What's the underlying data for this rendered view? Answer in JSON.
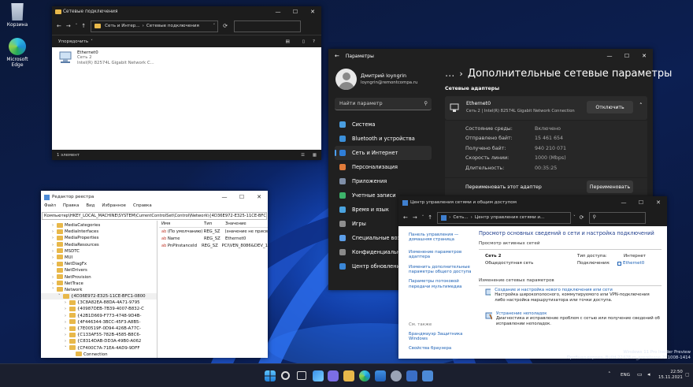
{
  "desktop": {
    "icons": [
      {
        "label": "Корзина"
      },
      {
        "label": "Microsoft\nEdge"
      }
    ],
    "watermark": {
      "line1": "Windows 11 Pro Insider Preview",
      "line2": "Пробная версия. Build 22478.rs_prerelease.211008-1414"
    }
  },
  "explorer": {
    "title": "Сетевые подключения",
    "breadcrumb": [
      "Сеть и Интер...",
      "Сетевые подключения"
    ],
    "search_placeholder": "",
    "toolbar_label": "Упорядочить",
    "item": {
      "name": "Ethernet0",
      "line2": "Сеть 2",
      "line3": "Intel(R) 82574L Gigabit Network C..."
    },
    "status": "1 элемент"
  },
  "regedit": {
    "title": "Редактор реестра",
    "menu": [
      "Файл",
      "Правка",
      "Вид",
      "Избранное",
      "Справка"
    ],
    "address": "Компьютер\\HKEY_LOCAL_MACHINE\\SYSTEM\\CurrentControlSet\\Control\\Network\\{4D36E972-E325-11CE-BFC1-0800",
    "tree": [
      {
        "label": "MediaCategories",
        "indent": 3,
        "exp": "›"
      },
      {
        "label": "MediaInterfaces",
        "indent": 3,
        "exp": "›"
      },
      {
        "label": "MediaProperties",
        "indent": 3,
        "exp": "›"
      },
      {
        "label": "MediaResources",
        "indent": 3,
        "exp": "›"
      },
      {
        "label": "MSDTC",
        "indent": 3,
        "exp": "›"
      },
      {
        "label": "MUI",
        "indent": 3,
        "exp": "›"
      },
      {
        "label": "NetDiagFx",
        "indent": 3,
        "exp": "›"
      },
      {
        "label": "NetDrivers",
        "indent": 3,
        "exp": ""
      },
      {
        "label": "NetProvision",
        "indent": 3,
        "exp": "›"
      },
      {
        "label": "NetTrace",
        "indent": 3,
        "exp": "›"
      },
      {
        "label": "Network",
        "indent": 3,
        "exp": "˅"
      },
      {
        "label": "{4D36E972-E325-11CE-BFC1-0800",
        "indent": 4,
        "exp": "˅"
      },
      {
        "label": "{3C8A82EA-88DA-4A71-9795",
        "indent": 5,
        "exp": "›"
      },
      {
        "label": "{40987DEB-7B39-4007-B832-C",
        "indent": 5,
        "exp": "›"
      },
      {
        "label": "{42B1D669-F773-4748-9D4B-",
        "indent": 5,
        "exp": "›"
      },
      {
        "label": "{4F446344-3BCC-45F3-A8B5-",
        "indent": 5,
        "exp": "›"
      },
      {
        "label": "{7E00519F-0D94-426B-A77C-",
        "indent": 5,
        "exp": "›"
      },
      {
        "label": "{C133AF55-782B-4585-B8C6-",
        "indent": 5,
        "exp": "›"
      },
      {
        "label": "{C8314DAB-DD3A-49B0-A062",
        "indent": 5,
        "exp": "›"
      },
      {
        "label": "{CF400C7A-71EA-4AD9-9DFF",
        "indent": 5,
        "exp": "˅"
      },
      {
        "label": "Connection",
        "indent": 6,
        "exp": ""
      }
    ],
    "columns": [
      "Имя",
      "Тип",
      "Значение"
    ],
    "rows": [
      {
        "name": "(По умолчанию)",
        "type": "REG_SZ",
        "value": "(значение не присв"
      },
      {
        "name": "Name",
        "type": "REG_SZ",
        "value": "Ethernet0"
      },
      {
        "name": "PnPInstanceId",
        "type": "REG_SZ",
        "value": "PCI\\VEN_8086&DEV_1"
      }
    ]
  },
  "settings": {
    "title": "Параметры",
    "user": {
      "name": "Дмитрий loyngrin",
      "email": "loyngrin@remontcompa.ru"
    },
    "search_placeholder": "Найти параметр",
    "nav": [
      {
        "label": "Система",
        "color": "#4a9ee0"
      },
      {
        "label": "Bluetooth и устройства",
        "color": "#3b8fd9"
      },
      {
        "label": "Сеть и Интернет",
        "color": "#2f7ed8"
      },
      {
        "label": "Персонализация",
        "color": "#e07b3a"
      },
      {
        "label": "Приложения",
        "color": "#7f8fa8"
      },
      {
        "label": "Учетные записи",
        "color": "#3db36a"
      },
      {
        "label": "Время и язык",
        "color": "#4aa3df"
      },
      {
        "label": "Игры",
        "color": "#8e8e8e"
      },
      {
        "label": "Специальные возможности",
        "color": "#5c9ee8"
      },
      {
        "label": "Конфиденциальность",
        "color": "#8a8a8a"
      },
      {
        "label": "Центр обновления Windows",
        "color": "#3a86d6"
      }
    ],
    "breadcrumb_parent": "...",
    "page_title": "Дополнительные сетевые параметры",
    "section": "Сетевые адаптеры",
    "adapter": {
      "name": "Ethernet0",
      "desc": "Сеть 2 | Intel(R) 82574L Gigabit Network Connection",
      "disable_label": "Отключить"
    },
    "stats": [
      {
        "k": "Состояние среды:",
        "v": "Включено"
      },
      {
        "k": "Отправлено байт:",
        "v": "15 461 654"
      },
      {
        "k": "Получено байт:",
        "v": "940 210 071"
      },
      {
        "k": "Скорость линии:",
        "v": "1000 (Mbps)"
      },
      {
        "k": "Длительность:",
        "v": "00:35:25"
      }
    ],
    "rename": {
      "label": "Переименовать этот адаптер",
      "button": "Переименовать"
    }
  },
  "control_panel": {
    "title": "Центр управления сетями и общим доступом",
    "breadcrumb": [
      "Сеть...",
      "Центр управления сетями и..."
    ],
    "sidebar_links": [
      "Панель управления — домашняя страница",
      "Изменение параметров адаптера",
      "Изменить дополнительные параметры общего доступа",
      "Параметры потоковой передачи мультимедиа"
    ],
    "see_also_heading": "См. также",
    "see_also": [
      "Брандмауэр Защитника Windows",
      "Свойства браузера"
    ],
    "heading": "Просмотр основных сведений о сети и настройка подключений",
    "active_networks": "Просмотр активных сетей",
    "network_name": "Сеть 2",
    "network_type": "Общедоступная сеть",
    "access_type_label": "Тип доступа:",
    "access_type": "Интернет",
    "connections_label": "Подключения:",
    "connection": "Ethernet0",
    "change_heading": "Изменение сетевых параметров",
    "tasks": [
      {
        "title": "Создание и настройка нового подключения или сети",
        "desc": "Настройка широкополосного, коммутируемого или VPN-подключения либо настройка маршрутизатора или точки доступа."
      },
      {
        "title": "Устранение неполадок",
        "desc": "Диагностика и исправление проблем с сетью или получение сведений об исправлении неполадок."
      }
    ]
  },
  "taskbar": {
    "lang": "ENG",
    "time": "22:50",
    "date": "15.11.2021"
  }
}
